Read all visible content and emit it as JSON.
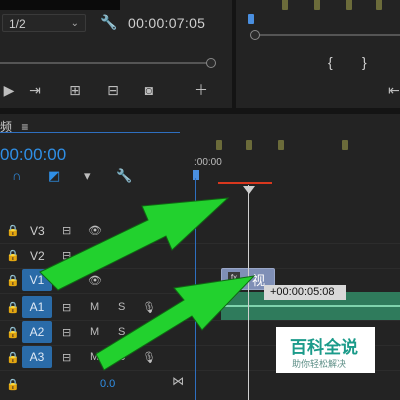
{
  "source_monitor": {
    "zoom_value": "1/2",
    "timecode": "00:00:07:05"
  },
  "timeline": {
    "panel_title": "频",
    "panel_menu": "≡",
    "timecode": "00:00:00",
    "ruler_start": ":00:00",
    "tracks": [
      {
        "label": "V3",
        "kind": "video"
      },
      {
        "label": "V2",
        "kind": "video"
      },
      {
        "label": "V1",
        "kind": "video"
      },
      {
        "label": "A1",
        "kind": "audio",
        "m": "M",
        "s": "S"
      },
      {
        "label": "A2",
        "kind": "audio",
        "m": "M",
        "s": "S"
      },
      {
        "label": "A3",
        "kind": "audio",
        "m": "M",
        "s": "S"
      }
    ],
    "clip_label": "视",
    "drag_timecode": "+00:00:05:08",
    "bottom_value": "0.0"
  },
  "watermark": {
    "line1": "百科全说",
    "line2": "助你轻松解决"
  },
  "colors": {
    "accent_blue": "#2f8fe6",
    "arrow_green": "#22d12e",
    "clip_video": "#7f8fb6",
    "clip_audio": "#2f7b5c",
    "in_out_red": "#d9381e"
  }
}
